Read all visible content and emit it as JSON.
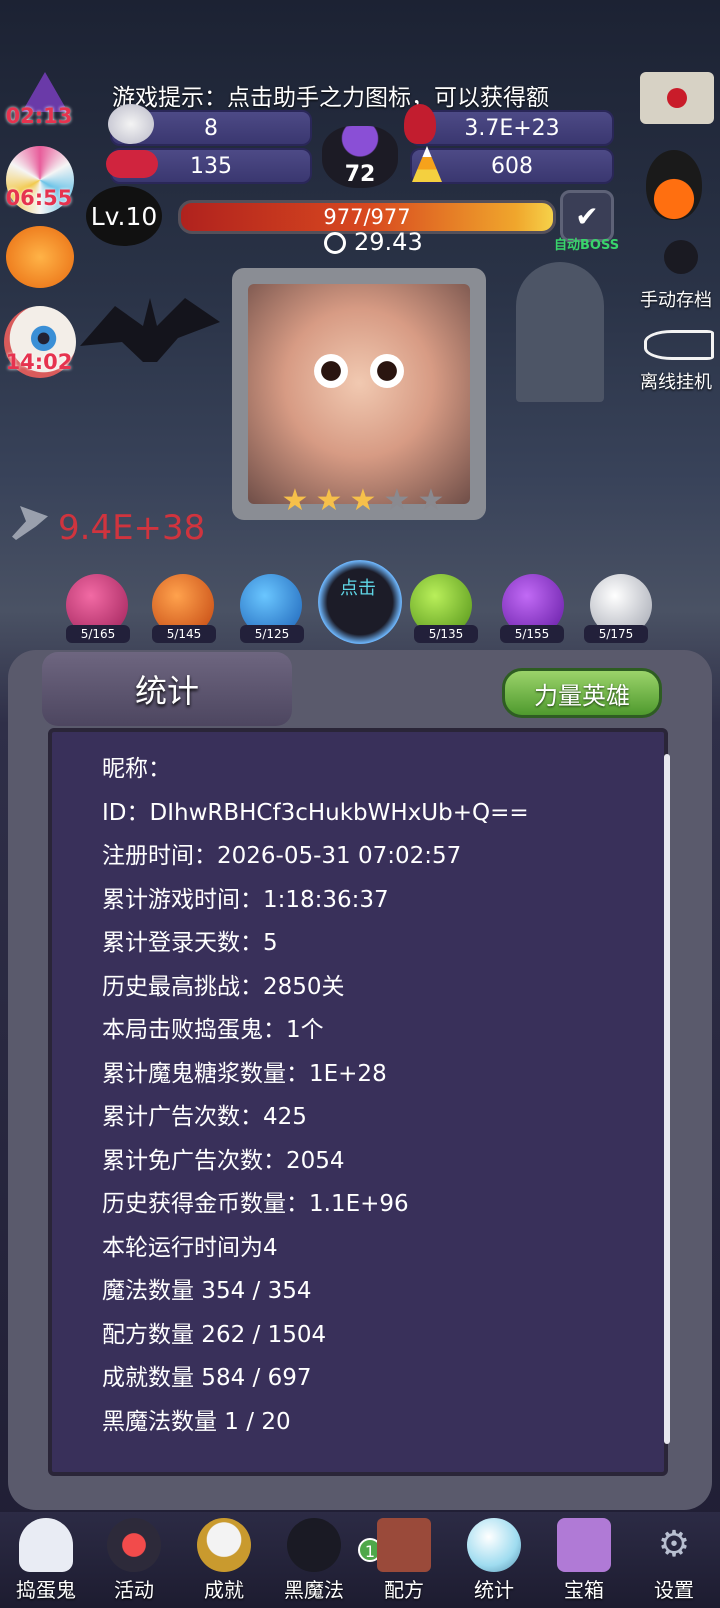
{
  "hint": "游戏提示：点击助手之力图标，可以获得额",
  "resources": {
    "left_top": "8",
    "left_bottom": "135",
    "right_top": "3.7E+23",
    "right_bottom": "608",
    "cauldron": "72"
  },
  "side_timers": [
    "02:13",
    "06:55",
    "14:02"
  ],
  "level": "Lv.10",
  "hp": "977/977",
  "timer": "29.43",
  "auto_boss": "自动BOSS",
  "side_actions": {
    "manual_save": "手动存档",
    "offline": "离线挂机"
  },
  "damage": "9.4E+38",
  "tap_label": "点击",
  "ghost_counts": [
    "5/165",
    "5/145",
    "5/125",
    "5/135",
    "5/155",
    "5/175"
  ],
  "panel": {
    "title": "统计",
    "hero_button": "力量英雄",
    "stats": [
      "昵称：",
      "ID：DIhwRBHCf3cHukbWHxUb+Q==",
      "注册时间：2026-05-31 07:02:57",
      "累计游戏时间：1:18:36:37",
      "累计登录天数：5",
      "历史最高挑战：2850关",
      "本局击败捣蛋鬼：1个",
      "累计魔鬼糖浆数量：1E+28",
      "累计广告次数：425",
      "累计免广告次数：2054",
      "历史获得金币数量：1.1E+96",
      "本轮运行时间为4",
      "魔法数量 354 / 354",
      "配方数量 262 / 1504",
      "成就数量 584 / 697",
      "黑魔法数量 1 / 20"
    ]
  },
  "nav": {
    "badge": "1",
    "items": [
      "捣蛋鬼",
      "活动",
      "成就",
      "黑魔法",
      "配方",
      "统计",
      "宝箱",
      "设置"
    ]
  }
}
